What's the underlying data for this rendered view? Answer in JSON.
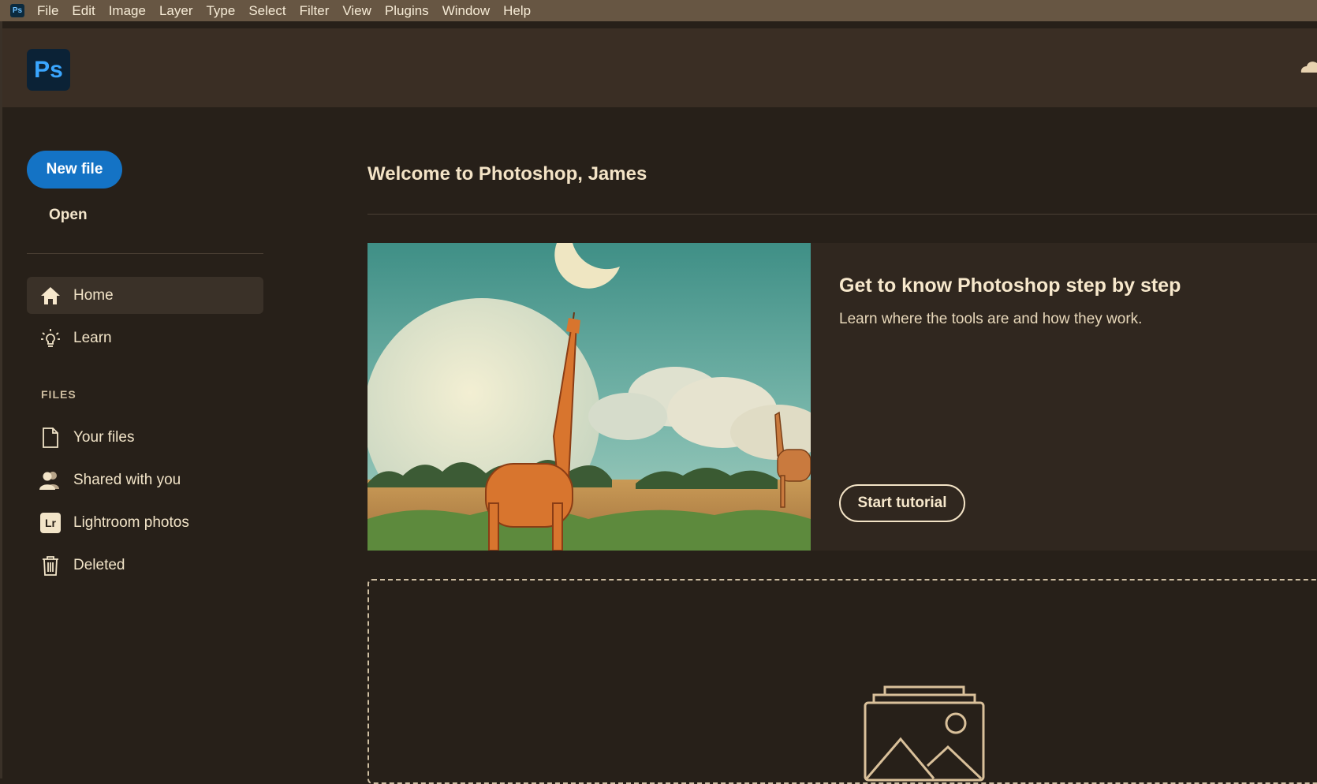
{
  "menubar": {
    "app_icon": "Ps",
    "items": [
      "File",
      "Edit",
      "Image",
      "Layer",
      "Type",
      "Select",
      "Filter",
      "View",
      "Plugins",
      "Window",
      "Help"
    ]
  },
  "header": {
    "logo_text": "Ps",
    "cloud_icon": "cloud-icon"
  },
  "sidebar": {
    "new_file_label": "New file",
    "open_label": "Open",
    "nav": [
      {
        "label": "Home",
        "icon": "home-icon",
        "active": true
      },
      {
        "label": "Learn",
        "icon": "lightbulb-icon",
        "active": false
      }
    ],
    "files_heading": "FILES",
    "files": [
      {
        "label": "Your files",
        "icon": "document-icon"
      },
      {
        "label": "Shared with you",
        "icon": "people-icon"
      },
      {
        "label": "Lightroom photos",
        "icon": "lightroom-icon",
        "icon_text": "Lr"
      },
      {
        "label": "Deleted",
        "icon": "trash-icon"
      }
    ]
  },
  "main": {
    "welcome": "Welcome to Photoshop, James",
    "tutorial": {
      "title": "Get to know Photoshop step by step",
      "subtitle": "Learn where the tools are and how they work.",
      "button_label": "Start tutorial"
    }
  },
  "colors": {
    "accent": "#1473c5",
    "menubar": "#675643",
    "background": "#272019"
  }
}
